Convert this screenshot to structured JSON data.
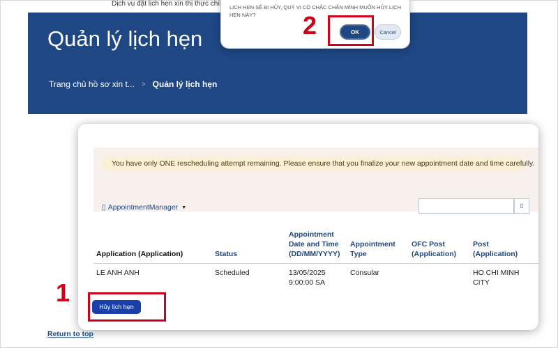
{
  "top_line": "Dịch vụ đặt lịch hẹn xin thị thực chính thứ",
  "header": {
    "title": "Quản lý lịch hẹn",
    "breadcrumb": {
      "home": "Trang chủ hồ sơ xin t...",
      "separator": ">",
      "current": "Quản lý lịch hẹn"
    }
  },
  "dialog": {
    "message": "LỊCH HẸN SẼ BỊ HỦY, QUÝ VỊ CÓ CHẮC CHẮN MÌNH MUỐN HỦY LỊCH HẸN NÀY?",
    "ok_label": "OK",
    "cancel_label": "Cancel"
  },
  "annotations": {
    "step1": "1",
    "step2": "2",
    "highlight_color": "#d0021b"
  },
  "panel": {
    "alert": "You have only ONE rescheduling attempt remaining. Please ensure that you finalize your new appointment date and time carefully.",
    "manager_icon": "doc-icon",
    "manager_label": "AppointmentManager",
    "search_placeholder": "",
    "search_icon": "search-icon"
  },
  "table": {
    "columns": [
      "Application (Application)",
      "Status",
      "Appointment Date and Time (DD/MM/YYYY)",
      "Appointment Type",
      "OFC Post (Application)",
      "Post (Application)"
    ],
    "rows": [
      {
        "application": "LE ANH ANH",
        "status": "Scheduled",
        "date": "13/05/2025",
        "time": "9:00:00 SA",
        "type": "Consular",
        "ofc_post": "",
        "post": "HO CHI MINH CITY"
      }
    ]
  },
  "cancel_appointment_label": "Hủy lịch hẹn",
  "return_link": "Return to top",
  "colors": {
    "brand_blue": "#1e4783",
    "alert_bg": "#fbf0d3",
    "button_blue": "#1a3fa8"
  }
}
